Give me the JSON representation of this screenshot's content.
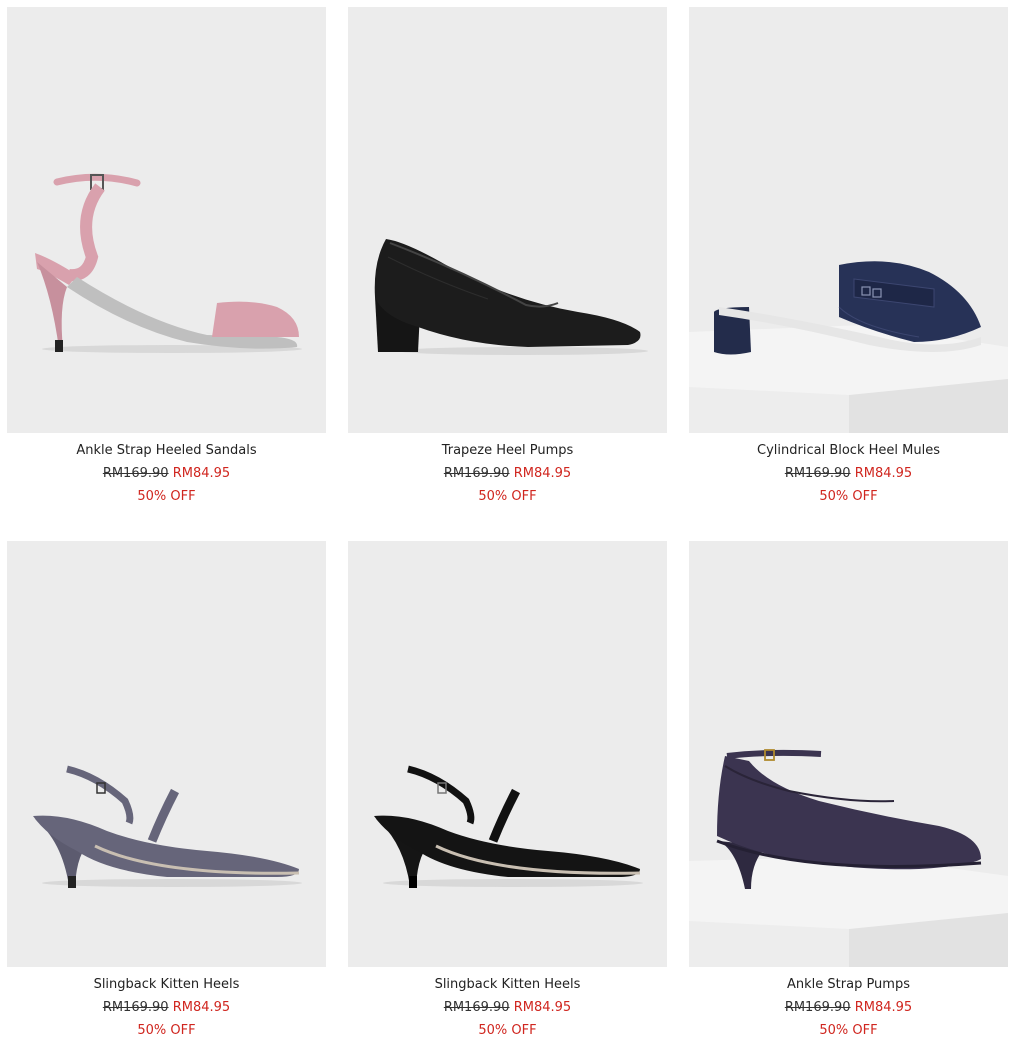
{
  "products": [
    {
      "name": "Ankle Strap Heeled Sandals",
      "original_price": "RM169.90",
      "sale_price": "RM84.95",
      "discount": "50% OFF",
      "shoe_color": "#d9a1ad",
      "shoe_icon": "pink-strappy-sandal"
    },
    {
      "name": "Trapeze Heel Pumps",
      "original_price": "RM169.90",
      "sale_price": "RM84.95",
      "discount": "50% OFF",
      "shoe_color": "#1a1a1a",
      "shoe_icon": "black-pump"
    },
    {
      "name": "Cylindrical Block Heel Mules",
      "original_price": "RM169.90",
      "sale_price": "RM84.95",
      "discount": "50% OFF",
      "shoe_color": "#273257",
      "shoe_icon": "navy-mule"
    },
    {
      "name": "Slingback Kitten Heels",
      "original_price": "RM169.90",
      "sale_price": "RM84.95",
      "discount": "50% OFF",
      "shoe_color": "#66657a",
      "shoe_icon": "grey-slingback"
    },
    {
      "name": "Slingback Kitten Heels",
      "original_price": "RM169.90",
      "sale_price": "RM84.95",
      "discount": "50% OFF",
      "shoe_color": "#111111",
      "shoe_icon": "black-slingback"
    },
    {
      "name": "Ankle Strap Pumps",
      "original_price": "RM169.90",
      "sale_price": "RM84.95",
      "discount": "50% OFF",
      "shoe_color": "#3b3450",
      "shoe_icon": "purple-ankle-strap-pump"
    }
  ],
  "colors": {
    "sale": "#d0261f",
    "image_bg": "#ececec"
  }
}
